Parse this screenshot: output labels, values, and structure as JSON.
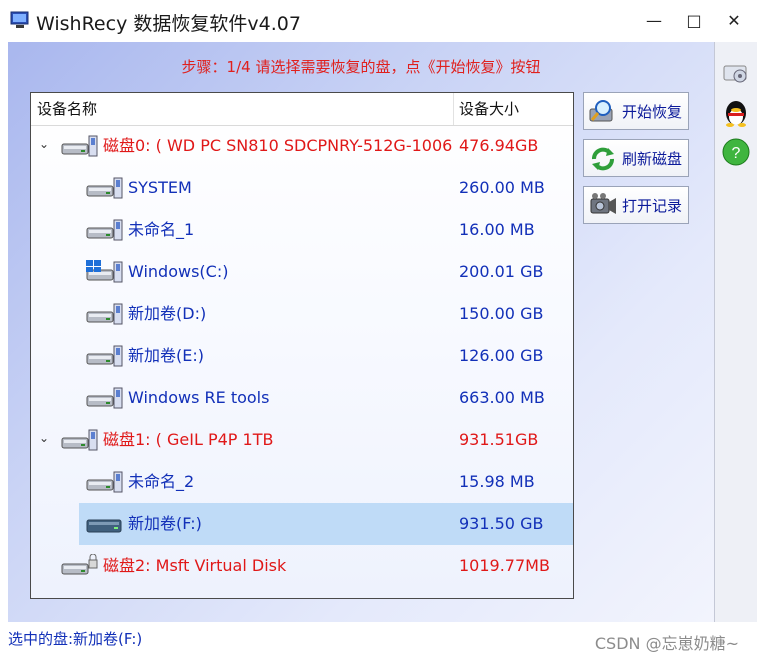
{
  "window": {
    "title": "WishRecy 数据恢复软件v4.07",
    "minimize_glyph": "—",
    "maximize_glyph": "□",
    "close_glyph": "✕"
  },
  "step_text": "步骤：1/4 请选择需要恢复的盘，点《开始恢复》按钮",
  "tree": {
    "columns": {
      "name": "设备名称",
      "size": "设备大小"
    },
    "rows": [
      {
        "kind": "disk",
        "label": "磁盘0: ( WD PC SN810 SDCPNRY-512G-1006",
        "size": "476.94GB",
        "toggle": "⌄"
      },
      {
        "kind": "part",
        "label": "SYSTEM",
        "size": "260.00 MB"
      },
      {
        "kind": "part",
        "label": "未命名_1",
        "size": "16.00 MB"
      },
      {
        "kind": "part",
        "label": "Windows(C:)",
        "size": "200.01 GB"
      },
      {
        "kind": "part",
        "label": "新加卷(D:)",
        "size": "150.00 GB"
      },
      {
        "kind": "part",
        "label": "新加卷(E:)",
        "size": "126.00 GB"
      },
      {
        "kind": "part",
        "label": "Windows RE tools",
        "size": "663.00 MB"
      },
      {
        "kind": "disk",
        "label": "磁盘1: ( GeIL P4P 1TB",
        "size": "931.51GB",
        "toggle": "⌄"
      },
      {
        "kind": "part",
        "label": "未命名_2",
        "size": "15.98 MB"
      },
      {
        "kind": "part",
        "label": "新加卷(F:)",
        "size": "931.50 GB",
        "selected": true
      },
      {
        "kind": "disk",
        "label": "磁盘2: Msft     Virtual Disk",
        "size": "1019.77MB"
      }
    ]
  },
  "actions": [
    {
      "label": "开始恢复",
      "icon": "magnifier-icon"
    },
    {
      "label": "刷新磁盘",
      "icon": "refresh-icon"
    },
    {
      "label": "打开记录",
      "icon": "camera-icon"
    }
  ],
  "side_icons": [
    "settings-disk-icon",
    "qq-penguin-icon",
    "help-icon"
  ],
  "status": "选中的盘:新加卷(F:)",
  "watermark": "CSDN @忘崽奶糖~",
  "colors": {
    "disk_text": "#e01818",
    "partition_text": "#1230b8",
    "step_text": "#e0201d",
    "selected_row": "#bfdbf7"
  }
}
